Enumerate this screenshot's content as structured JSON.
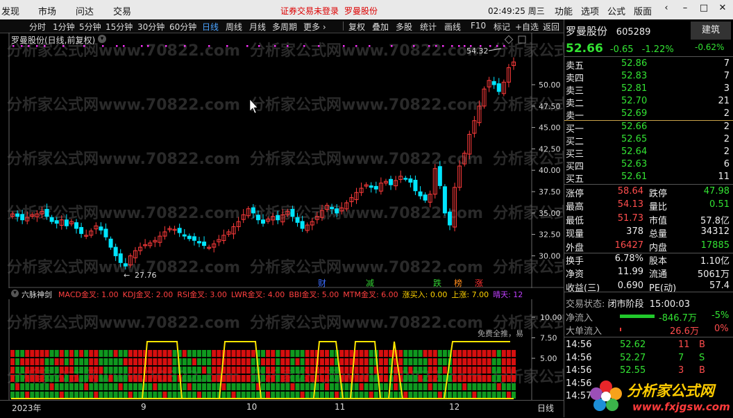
{
  "menu": {
    "items": [
      "发现",
      "市场",
      "问达",
      "交易"
    ],
    "status_warning": "证券交易未登录",
    "stock_name": "罗曼股份",
    "time": "02:49:25 周三",
    "right_items": [
      "功能",
      "选项",
      "公式",
      "版面"
    ],
    "win_buttons": [
      "‹",
      "–",
      "□",
      "✕"
    ]
  },
  "toolbar": {
    "periods": [
      "分时",
      "1分钟",
      "5分钟",
      "15分钟",
      "30分钟",
      "60分钟",
      "日线",
      "周线",
      "月线",
      "多周期",
      "更多 ›"
    ],
    "active": "日线",
    "actions": [
      "复权",
      "叠加",
      "多股",
      "统计",
      "画线",
      "F10",
      "标记",
      "+自选",
      "返回"
    ]
  },
  "chart": {
    "title": "罗曼股份(日线,前复权)",
    "price_ticks": [
      "50.00",
      "47.50",
      "45.00",
      "42.50",
      "40.00",
      "37.50",
      "35.00",
      "32.50",
      "30.00"
    ],
    "high_label": "54.32",
    "low_label": "27.76",
    "watermark": "分析家公式网www.70822.com"
  },
  "indicator": {
    "name": "六脉神剑",
    "items": [
      {
        "text": "MACD金叉: 1.00",
        "color": "#ff4040"
      },
      {
        "text": "KDJ金叉: 2.00",
        "color": "#ff4040"
      },
      {
        "text": "RSI金叉: 3.00",
        "color": "#ff4040"
      },
      {
        "text": "LWR金叉: 4.00",
        "color": "#ff4040"
      },
      {
        "text": "BBI金叉: 5.00",
        "color": "#ff4040"
      },
      {
        "text": "MTM金叉: 6.00",
        "color": "#ff4040"
      },
      {
        "text": "涨买入: 0.00",
        "color": "#ffd200"
      },
      {
        "text": "上涨: 7.00",
        "color": "#ffd200"
      },
      {
        "text": "晴天: 12",
        "color": "#c040ff"
      }
    ],
    "ticks": [
      "10.00",
      "7.50",
      "5.00"
    ],
    "marker_labels": [
      {
        "text": "财",
        "color": "#3b6cff"
      },
      {
        "text": "减",
        "color": "#33d033"
      },
      {
        "text": "跌",
        "color": "#33d033"
      },
      {
        "text": "榜",
        "color": "#ff8c1a"
      },
      {
        "text": "涨",
        "color": "#ff3030"
      }
    ],
    "free_label": "免费全推，易"
  },
  "xaxis": {
    "labels": [
      "2023年",
      "9",
      "10",
      "11",
      "12"
    ],
    "period": "日线"
  },
  "quote": {
    "name": "罗曼股份",
    "code": "605289",
    "sector": "建筑",
    "sector_pct": "-0.62%",
    "price": "52.66",
    "change": "-0.65",
    "pct": "-1.22%",
    "asks": [
      {
        "label": "卖五",
        "price": "52.86",
        "vol": "7"
      },
      {
        "label": "卖四",
        "price": "52.83",
        "vol": "7"
      },
      {
        "label": "卖三",
        "price": "52.81",
        "vol": "3"
      },
      {
        "label": "卖二",
        "price": "52.70",
        "vol": "21"
      },
      {
        "label": "卖一",
        "price": "52.69",
        "vol": "2"
      }
    ],
    "bids": [
      {
        "label": "买一",
        "price": "52.66",
        "vol": "2"
      },
      {
        "label": "买二",
        "price": "52.65",
        "vol": "2"
      },
      {
        "label": "买三",
        "price": "52.64",
        "vol": "2"
      },
      {
        "label": "买四",
        "price": "52.63",
        "vol": "6"
      },
      {
        "label": "买五",
        "price": "52.61",
        "vol": "11"
      }
    ],
    "stats": [
      {
        "l1": "涨停",
        "v1": "58.64",
        "c1": "red",
        "l2": "跌停",
        "v2": "47.98",
        "c2": "green"
      },
      {
        "l1": "最高",
        "v1": "54.13",
        "c1": "red",
        "l2": "量比",
        "v2": "0.51",
        "c2": "green"
      },
      {
        "l1": "最低",
        "v1": "51.73",
        "c1": "red",
        "l2": "市值",
        "v2": "57.8亿",
        "c2": "white"
      },
      {
        "l1": "现量",
        "v1": "378",
        "c1": "white",
        "l2": "总量",
        "v2": "34312",
        "c2": "white"
      },
      {
        "l1": "外盘",
        "v1": "16427",
        "c1": "red",
        "l2": "内盘",
        "v2": "17885",
        "c2": "green"
      },
      {
        "l1": "换手",
        "v1": "6.78%",
        "c1": "white",
        "l2": "股本",
        "v2": "1.10亿",
        "c2": "white"
      },
      {
        "l1": "净资",
        "v1": "11.99",
        "c1": "white",
        "l2": "流通",
        "v2": "5061万",
        "c2": "white"
      },
      {
        "l1": "收益(三)",
        "v1": "0.690",
        "c1": "white",
        "l2": "PE(动)",
        "v2": "57.4",
        "c2": "white"
      }
    ],
    "trade_status_label": "交易状态:",
    "trade_status": "闭市阶段",
    "trade_time": "15:00:03",
    "net_inflow_label": "净流入",
    "net_inflow": "-846.7万",
    "net_inflow_pct": "-5%",
    "big_inflow_label": "大单流入",
    "big_inflow": "26.6万",
    "big_inflow_pct": "0%",
    "ticks": [
      {
        "time": "14:56",
        "price": "52.62",
        "vol": "11",
        "side": "B"
      },
      {
        "time": "14:56",
        "price": "52.27",
        "vol": "7",
        "side": "S"
      },
      {
        "time": "14:56",
        "price": "52.55",
        "vol": "3",
        "side": "B"
      },
      {
        "time": "14:56",
        "price": "",
        "vol": "",
        "side": ""
      },
      {
        "time": "14:57",
        "price": "",
        "vol": "",
        "side": ""
      }
    ]
  },
  "logo": {
    "title": "分析家公式网",
    "url": "www.fxjgsw.com"
  },
  "colors": {
    "up": "#ff3b3b",
    "down": "#00e5ff",
    "ma": "#ffffff",
    "accent": "#4aa3ff"
  }
}
